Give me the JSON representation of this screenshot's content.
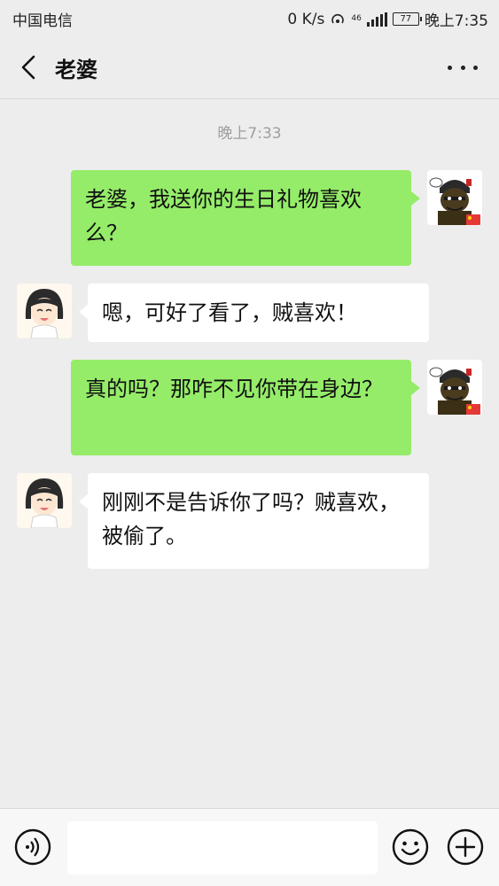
{
  "status_bar": {
    "carrier": "中国电信",
    "net_speed": "0 K/s",
    "net_small_top": "46",
    "battery": "77",
    "time": "晚上7:35"
  },
  "header": {
    "title": "老婆",
    "back_icon": "chevron-left-icon",
    "more_icon": "more-dots-icon"
  },
  "chat": {
    "timestamp": "晚上7:33",
    "messages": [
      {
        "direction": "out",
        "text": "老婆，我送你的生日礼物喜欢么？"
      },
      {
        "direction": "in",
        "text": "嗯，可好了看了，贼喜欢！"
      },
      {
        "direction": "out",
        "text": "真的吗？那咋不见你带在身边？"
      },
      {
        "direction": "in",
        "text": "刚刚不是告诉你了吗？贼喜欢，被偷了。"
      }
    ]
  },
  "input_bar": {
    "voice_icon": "voice-icon",
    "emoji_icon": "emoji-icon",
    "plus_icon": "plus-icon",
    "input_value": ""
  },
  "colors": {
    "outgoing_bubble": "#95ec69",
    "incoming_bubble": "#ffffff",
    "background": "#ededed"
  }
}
